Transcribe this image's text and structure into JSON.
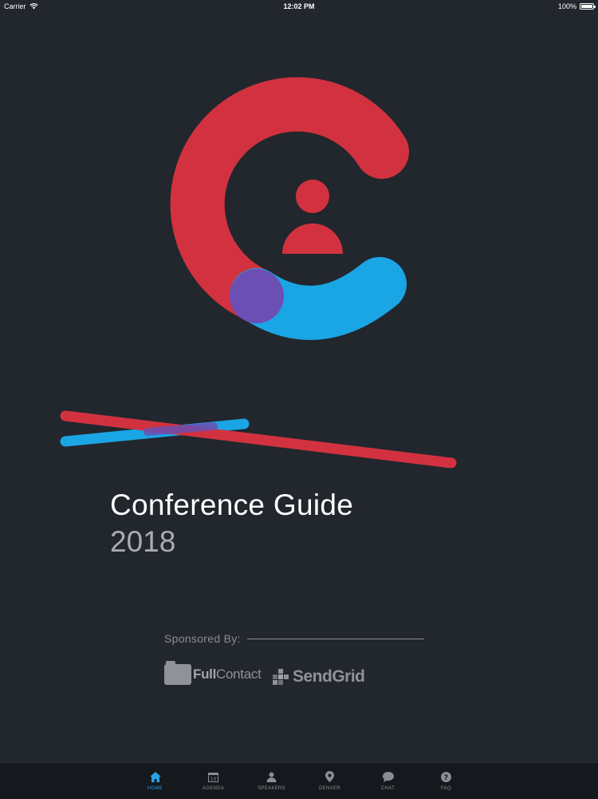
{
  "status_bar": {
    "carrier": "Carrier",
    "time": "12:02 PM",
    "battery": "100%"
  },
  "colors": {
    "background": "#22262d",
    "brand_red": "#d2323f",
    "brand_blue": "#1aa5e5",
    "brand_purple": "#6b4fb3",
    "tab_active": "#2aa0e6"
  },
  "hero": {
    "title": "Conference Guide",
    "year": "2018"
  },
  "sponsors": {
    "label": "Sponsored By:",
    "fullcontact": {
      "prefix": "Full",
      "suffix": "Contact"
    },
    "sendgrid": "SendGrid"
  },
  "tabs": [
    {
      "label": "HOME",
      "icon": "home-icon",
      "active": true
    },
    {
      "label": "AGENDA",
      "icon": "calendar-icon",
      "active": false
    },
    {
      "label": "SPEAKERS",
      "icon": "person-icon",
      "active": false
    },
    {
      "label": "DENVER",
      "icon": "location-pin-icon",
      "active": false
    },
    {
      "label": "CHAT",
      "icon": "chat-bubble-icon",
      "active": false
    },
    {
      "label": "FAQ",
      "icon": "question-icon",
      "active": false
    }
  ]
}
